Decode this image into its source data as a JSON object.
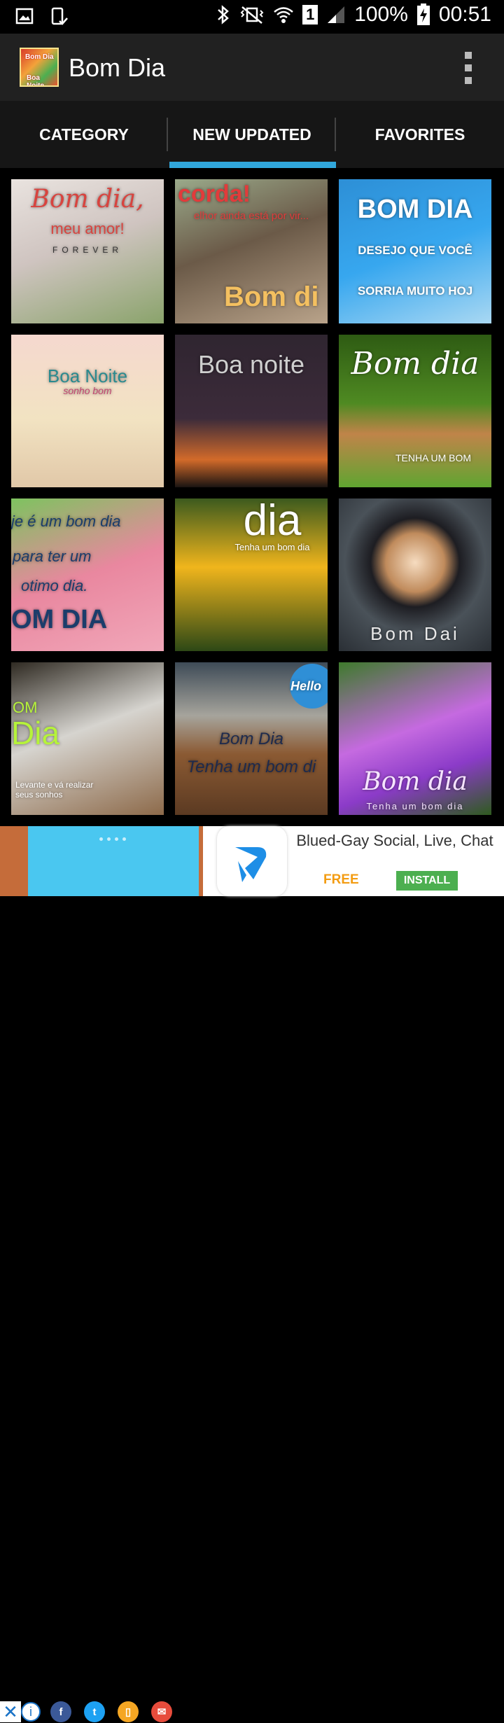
{
  "status_bar": {
    "battery": "100%",
    "time": "00:51",
    "sim_slot": "1"
  },
  "app_bar": {
    "title": "Bom Dia",
    "icon_text_top": "Bom Dia",
    "icon_text_bottom": "Boa Noite"
  },
  "tabs": [
    {
      "label": "CATEGORY",
      "selected": false
    },
    {
      "label": "NEW UPDATED",
      "selected": true
    },
    {
      "label": "FAVORITES",
      "selected": false
    }
  ],
  "tiles": [
    {
      "lines": [
        "Bom dia,",
        "meu amor!",
        "FOREVER"
      ],
      "bg": "linear-gradient(160deg,#e9e3df 0%,#cfc4c0 45%,#8aa36b 100%)",
      "color": "#d8443f"
    },
    {
      "lines": [
        "corda!",
        "elhor ainda está por vir...",
        "Bom di"
      ],
      "bg": "linear-gradient(160deg,#9aa98a 0%,#6b5a48 45%,#b9a38a 100%)",
      "color": "#e23b3b"
    },
    {
      "lines": [
        "BOM DIA",
        "DESEJO QUE VOCÊ",
        "SORRIA MUITO HOJ"
      ],
      "bg": "linear-gradient(160deg,#2d8fd6 0%,#37a7ef 50%,#a9d8f3 100%)",
      "color": "#ffffff"
    },
    {
      "lines": [
        "Boa Noite",
        "sonho bom"
      ],
      "bg": "linear-gradient(180deg,#f5d8cf 0%,#f2e3c2 55%,#e1c8a8 100%)",
      "color": "#2a8a8f"
    },
    {
      "lines": [
        "Boa noite"
      ],
      "bg": "linear-gradient(180deg,#2f2530 0%,#3c2b3a 55%,#d26a2a 82%,#1a1412 100%)",
      "color": "#cfcfcf"
    },
    {
      "lines": [
        "Bom dia",
        "TENHA UM BOM"
      ],
      "bg": "linear-gradient(180deg,#2e5b13 0%,#4f8a22 45%,#c08449 65%,#60a531 100%)",
      "color": "#ffffff"
    },
    {
      "lines": [
        "je é um bom dia",
        "para ter um",
        "otimo dia.",
        "OM DIA"
      ],
      "bg": "linear-gradient(160deg,#7dc35f 0%,#e9879f 50%,#f1a7b9 100%)",
      "color": "#1b3d6b"
    },
    {
      "lines": [
        "dia",
        "Tenha um bom dia"
      ],
      "bg": "linear-gradient(180deg,#3c5a1e 0%,#f0b51c 45%,#2d4816 100%)",
      "color": "#ffffff"
    },
    {
      "lines": [
        "Bom Dai"
      ],
      "bg": "radial-gradient(circle at 50% 42%,#f6dcc0 0%,#c08b5c 25%,#1d1d22 38%,#4a5259 60%,#2a2f35 100%)",
      "color": "#e8e8e8"
    },
    {
      "lines": [
        "OM",
        "Dia",
        "Levante e vá realizar seus sonhos"
      ],
      "bg": "linear-gradient(160deg,#2f2a22 0%,#d6d4cf 45%,#8d6a4a 100%)",
      "color": "#b6f33a"
    },
    {
      "lines": [
        "Hello",
        "Bom Dia",
        "Tenha um bom di"
      ],
      "bg": "linear-gradient(180deg,#3e4b57 0%,#a6a49c 35%,#8b5a33 60%,#5b3a22 100%)",
      "color": "#1d2a4d"
    },
    {
      "lines": [
        "Bom dia",
        "Tenha um bom dia"
      ],
      "bg": "linear-gradient(160deg,#3e7a2c 0%,#c56ae0 45%,#8b3bc8 70%,#2e5b1e 100%)",
      "color": "#f6e4ff"
    }
  ],
  "ad": {
    "title": "Blued-Gay Social, Live, Chat",
    "free_label": "FREE",
    "install_label": "INSTALL"
  },
  "colors": {
    "accent": "#31a7dc",
    "app_bar": "#212121",
    "tab_bar": "#161616"
  }
}
